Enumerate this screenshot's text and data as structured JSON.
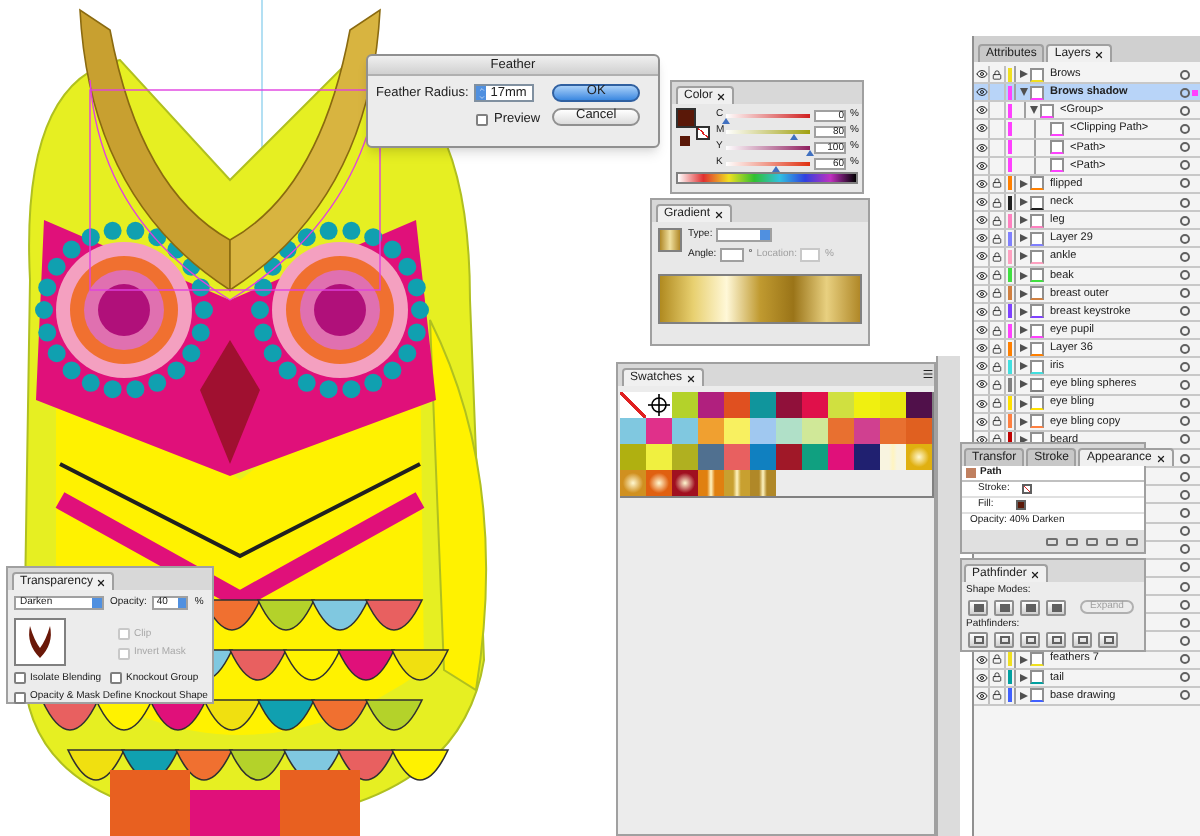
{
  "feather_dialog": {
    "title": "Feather",
    "radius_label": "Feather Radius:",
    "radius_value": "17mm",
    "preview_label": "Preview",
    "preview_checked": false,
    "buttons": [
      {
        "label": "OK",
        "default": true
      },
      {
        "label": "Cancel",
        "default": false
      }
    ]
  },
  "color_panel": {
    "tab": "Color",
    "channels": [
      {
        "name": "C",
        "value": "0",
        "level": 0
      },
      {
        "name": "M",
        "value": "80",
        "level": 0.8
      },
      {
        "name": "Y",
        "value": "100",
        "level": 1
      },
      {
        "name": "K",
        "value": "60",
        "level": 0.6
      }
    ],
    "unit": "%"
  },
  "gradient_panel": {
    "tab": "Gradient",
    "type_label": "Type:",
    "angle_label": "Angle:",
    "degree": "°",
    "location_label": "Location:",
    "location_unit": "%"
  },
  "swatches_panel": {
    "tab": "Swatches",
    "swatches": [
      {
        "kind": "none"
      },
      {
        "kind": "registration"
      },
      {
        "kind": "solid",
        "color": "#b4d22a"
      },
      {
        "kind": "solid",
        "color": "#b0207e"
      },
      {
        "kind": "solid",
        "color": "#e05020"
      },
      {
        "kind": "solid",
        "color": "#10959c"
      },
      {
        "kind": "solid",
        "color": "#90103a"
      },
      {
        "kind": "solid",
        "color": "#e0104a"
      },
      {
        "kind": "solid",
        "color": "#d0e040"
      },
      {
        "kind": "solid",
        "color": "#f0f010"
      },
      {
        "kind": "solid",
        "color": "#e8e810"
      },
      {
        "kind": "solid",
        "color": "#50104a"
      },
      {
        "kind": "solid",
        "color": "#80c8e0"
      },
      {
        "kind": "solid",
        "color": "#e0308a"
      },
      {
        "kind": "solid",
        "color": "#80c8e0"
      },
      {
        "kind": "solid",
        "color": "#f0a030"
      },
      {
        "kind": "solid",
        "color": "#f8f060"
      },
      {
        "kind": "solid",
        "color": "#a0c8f0"
      },
      {
        "kind": "solid",
        "color": "#b0e0c8"
      },
      {
        "kind": "solid",
        "color": "#d0e898"
      },
      {
        "kind": "solid",
        "color": "#e87030"
      },
      {
        "kind": "solid",
        "color": "#d04090"
      },
      {
        "kind": "solid",
        "color": "#e87030"
      },
      {
        "kind": "solid",
        "color": "#e06020"
      },
      {
        "kind": "solid",
        "color": "#b0b010"
      },
      {
        "kind": "solid",
        "color": "#f0f040"
      },
      {
        "kind": "solid",
        "color": "#b0b020"
      },
      {
        "kind": "solid",
        "color": "#507090"
      },
      {
        "kind": "solid",
        "color": "#e86060"
      },
      {
        "kind": "solid",
        "color": "#1080c0"
      },
      {
        "kind": "solid",
        "color": "#a01828"
      },
      {
        "kind": "solid",
        "color": "#10a080"
      },
      {
        "kind": "solid",
        "color": "#e0107a"
      },
      {
        "kind": "solid",
        "color": "#202070"
      },
      {
        "kind": "linear",
        "color": "#f8f4e0"
      },
      {
        "kind": "radial",
        "color": "#e0b010"
      },
      {
        "kind": "radial",
        "color": "#d09020"
      },
      {
        "kind": "radial",
        "color": "#e06010"
      },
      {
        "kind": "radial",
        "color": "#a01020"
      },
      {
        "kind": "linear",
        "color": "#e08010"
      },
      {
        "kind": "linear",
        "color": "#c8a030"
      },
      {
        "kind": "linear",
        "color": "#b08828"
      }
    ]
  },
  "transparency_panel": {
    "tab": "Transparency",
    "blend_mode": "Darken",
    "opacity_label": "Opacity:",
    "opacity_value": "40",
    "unit": "%",
    "mask_options": [
      {
        "label": "Clip",
        "checked": false,
        "disabled": true
      },
      {
        "label": "Invert Mask",
        "checked": false,
        "disabled": true
      }
    ],
    "options": [
      {
        "label": "Isolate Blending",
        "checked": false
      },
      {
        "label": "Knockout Group",
        "checked": false
      },
      {
        "label": "Opacity & Mask Define Knockout Shape",
        "checked": false
      }
    ]
  },
  "appearance_panel": {
    "tabs": [
      {
        "label": "Transfor",
        "selected": false
      },
      {
        "label": "Stroke",
        "selected": false
      },
      {
        "label": "Appearance",
        "selected": true
      }
    ],
    "object": "Path",
    "stroke_label": "Stroke:",
    "fill_label": "Fill:",
    "opacity_line": "Opacity: 40% Darken"
  },
  "pathfinder_panel": {
    "tab": "Pathfinder",
    "shape_modes_label": "Shape Modes:",
    "expand_button": "Expand",
    "pathfinders_label": "Pathfinders:"
  },
  "layers_panel": {
    "tabs": [
      {
        "label": "Attributes",
        "selected": false
      },
      {
        "label": "Layers",
        "selected": true
      }
    ],
    "layers": [
      {
        "name": "Brows",
        "color": "#f0e020",
        "locked": true,
        "selected": false,
        "expanded": false
      },
      {
        "name": "Brows shadow",
        "color": "#ff40ff",
        "locked": false,
        "selected": true,
        "expanded": true,
        "children": [
          {
            "name": "<Group>",
            "locked": false,
            "selected": false,
            "expanded": true,
            "children": [
              {
                "name": "<Clipping Path>",
                "locked": false,
                "selected": false
              },
              {
                "name": "<Path>",
                "locked": false,
                "selected": false
              },
              {
                "name": "<Path>",
                "locked": false,
                "selected": false
              }
            ]
          }
        ]
      },
      {
        "name": "flipped",
        "color": "#ff8000",
        "locked": true,
        "selected": false,
        "expanded": false
      },
      {
        "name": "neck",
        "color": "#202020",
        "locked": true,
        "selected": false,
        "expanded": false
      },
      {
        "name": "leg",
        "color": "#ff80c0",
        "locked": true,
        "selected": false,
        "expanded": false
      },
      {
        "name": "Layer 29",
        "color": "#8080ff",
        "locked": true,
        "selected": false,
        "expanded": false
      },
      {
        "name": "ankle",
        "color": "#ffa0c0",
        "locked": true,
        "selected": false,
        "expanded": false
      },
      {
        "name": "beak",
        "color": "#40e040",
        "locked": true,
        "selected": false,
        "expanded": false
      },
      {
        "name": "breast outer",
        "color": "#d08040",
        "locked": true,
        "selected": false,
        "expanded": false
      },
      {
        "name": "breast keystroke",
        "color": "#8040ff",
        "locked": true,
        "selected": false,
        "expanded": false
      },
      {
        "name": "eye pupil",
        "color": "#ff40ff",
        "locked": true,
        "selected": false,
        "expanded": false
      },
      {
        "name": "Layer 36",
        "color": "#ff8000",
        "locked": true,
        "selected": false,
        "expanded": false
      },
      {
        "name": "iris",
        "color": "#40e0e0",
        "locked": true,
        "selected": false,
        "expanded": false
      },
      {
        "name": "eye bling spheres",
        "color": "#808080",
        "locked": true,
        "selected": false,
        "expanded": false
      },
      {
        "name": "eye bling",
        "color": "#ffe000",
        "locked": true,
        "selected": false,
        "expanded": false
      },
      {
        "name": "eye bling copy",
        "color": "#ff8040",
        "locked": true,
        "selected": false,
        "expanded": false
      },
      {
        "name": "beard",
        "color": "#c00000",
        "locked": true,
        "selected": false,
        "expanded": false
      }
    ],
    "lower_layers": [
      {
        "name": "feathers 7",
        "color": "#f0e020",
        "locked": true,
        "selected": false,
        "expanded": false
      },
      {
        "name": "tail",
        "color": "#00a0a0",
        "locked": true,
        "selected": false,
        "expanded": false
      },
      {
        "name": "base drawing",
        "color": "#4060ff",
        "locked": true,
        "selected": false,
        "expanded": false
      }
    ]
  }
}
